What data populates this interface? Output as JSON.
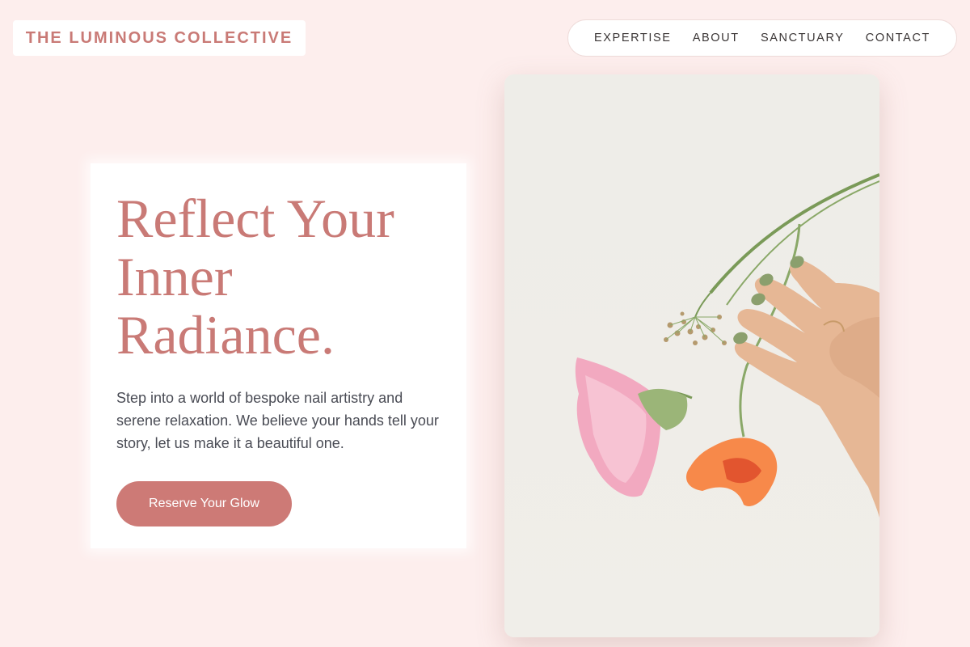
{
  "brand": {
    "name": "THE LUMINOUS COLLECTIVE"
  },
  "nav": {
    "items": [
      {
        "label": "EXPERTISE"
      },
      {
        "label": "ABOUT"
      },
      {
        "label": "SANCTUARY"
      },
      {
        "label": "CONTACT"
      }
    ]
  },
  "hero": {
    "title_lines": [
      "Reflect Your",
      "Inner",
      "Radiance."
    ],
    "description": "Step into a world of bespoke nail artistry and serene relaxation. We believe your hands tell your story, let us make it a beautiful one.",
    "cta_label": "Reserve Your Glow"
  },
  "image": {
    "subject": "hand-with-flowers-photo"
  },
  "colors": {
    "background": "#fdeeed",
    "accent": "#c97a76",
    "button": "#cd7a76",
    "text": "#4a4c55"
  }
}
